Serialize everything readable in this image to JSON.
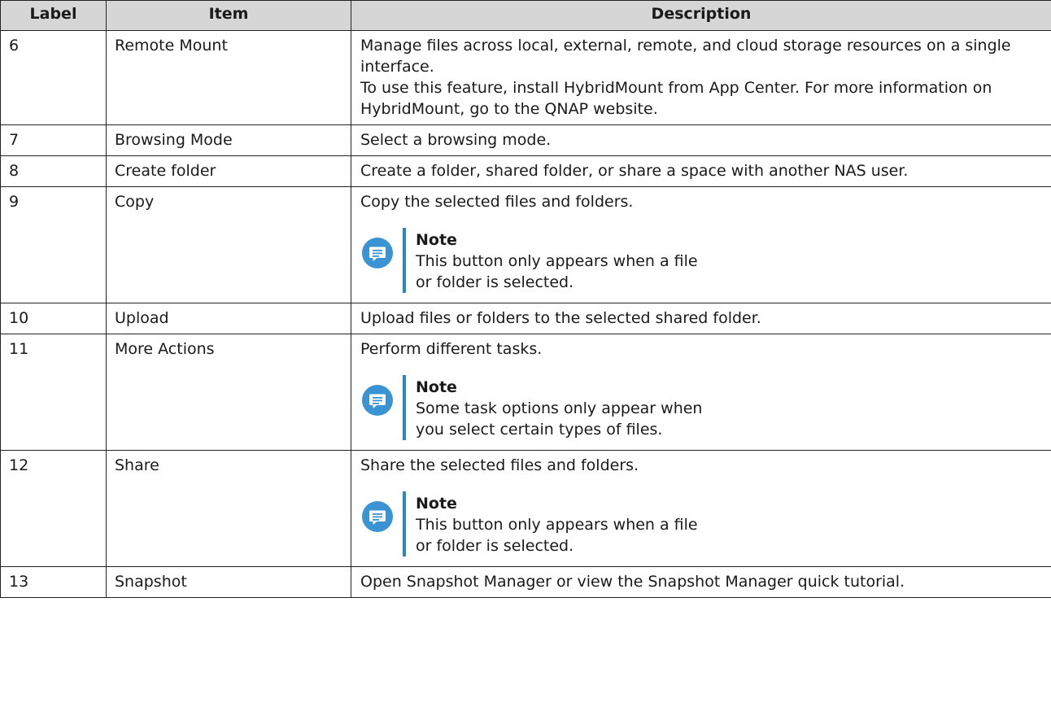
{
  "headers": {
    "label": "Label",
    "item": "Item",
    "description": "Description"
  },
  "rows": [
    {
      "label": "6",
      "item": "Remote Mount",
      "desc": [
        "Manage files across local, external, remote, and cloud storage resources on a single interface.",
        "To use this feature, install HybridMount from App Center. For more information on HybridMount, go to the QNAP website."
      ]
    },
    {
      "label": "7",
      "item": "Browsing Mode",
      "desc": [
        "Select a browsing mode."
      ]
    },
    {
      "label": "8",
      "item": "Create folder",
      "desc": [
        "Create a folder, shared folder, or share a space with another NAS user."
      ]
    },
    {
      "label": "9",
      "item": "Copy",
      "desc": [
        "Copy the selected files and folders."
      ],
      "note": {
        "title": "Note",
        "text": "This button only appears when a file or folder is selected."
      }
    },
    {
      "label": "10",
      "item": "Upload",
      "desc": [
        "Upload files or folders to the selected shared folder."
      ]
    },
    {
      "label": "11",
      "item": "More Actions",
      "desc": [
        "Perform different tasks."
      ],
      "note": {
        "title": "Note",
        "text": "Some task options only appear when you select certain types of files."
      }
    },
    {
      "label": "12",
      "item": "Share",
      "desc": [
        "Share the selected files and folders."
      ],
      "note": {
        "title": "Note",
        "text": "This button only appears when a file or folder is selected."
      }
    },
    {
      "label": "13",
      "item": "Snapshot",
      "desc": [
        "Open Snapshot Manager or view the Snapshot Manager quick tutorial."
      ]
    }
  ],
  "colors": {
    "header_bg": "#d6d6d6",
    "note_accent": "#2b86c7",
    "note_icon": "#3a93d2"
  },
  "icons": {
    "note": "note-icon"
  }
}
